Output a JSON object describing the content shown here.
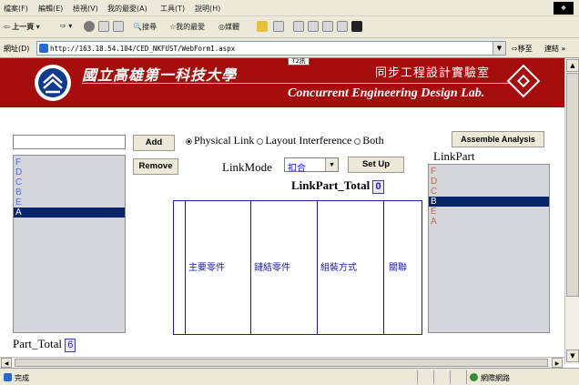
{
  "menubar": {
    "items": [
      "檔案(F)",
      "編輯(E)",
      "檢視(V)",
      "我的最愛(A)",
      "工具(T)",
      "說明(H)"
    ]
  },
  "toolbar": {
    "back": "上一頁",
    "search": "搜尋",
    "favorites": "我的最愛",
    "media": "媒體"
  },
  "addressbar": {
    "label": "網址(D)",
    "url": "http://163.18.54.104/CED_NKFUST/WebForm1.aspx",
    "go": "移至",
    "links": "連結 »"
  },
  "banner": {
    "school_cn": "國立高雄第一科技大學",
    "lab_cn": "同步工程設計實驗室",
    "lab_en": "Concurrent Engineering Design Lab.",
    "tag": "T2訊"
  },
  "left_panel": {
    "input_value": "",
    "items": [
      "F",
      "D",
      "C",
      "B",
      "E",
      "A"
    ],
    "selected": "A",
    "part_total_label": "Part_Total",
    "part_total_value": "6"
  },
  "buttons": {
    "add": "Add",
    "remove": "Remove",
    "set_up": "Set Up",
    "assemble": "Assemble Analysis"
  },
  "radios": {
    "physical": "Physical Link",
    "layout": "Layout Interference",
    "both": "Both",
    "selected": "physical"
  },
  "linkmode": {
    "label": "LinkMode",
    "value": "扣合"
  },
  "linkpart_total": {
    "label": "LinkPart_Total",
    "value": "0"
  },
  "table": {
    "headers": [
      "主要零件",
      "鏈結零件",
      "組裝方式",
      "關聯"
    ]
  },
  "right_panel": {
    "title": "LinkPart",
    "items": [
      "F",
      "D",
      "C",
      "B",
      "E",
      "A"
    ],
    "selected": "B"
  },
  "statusbar": {
    "text": "完成",
    "zone": "網際網路"
  },
  "colors": {
    "banner": "#a50d0d",
    "list_text": "#5a6ee0",
    "right_list_text": "#c07040",
    "selection": "#0a246a",
    "grid": "#1a1aa8"
  }
}
